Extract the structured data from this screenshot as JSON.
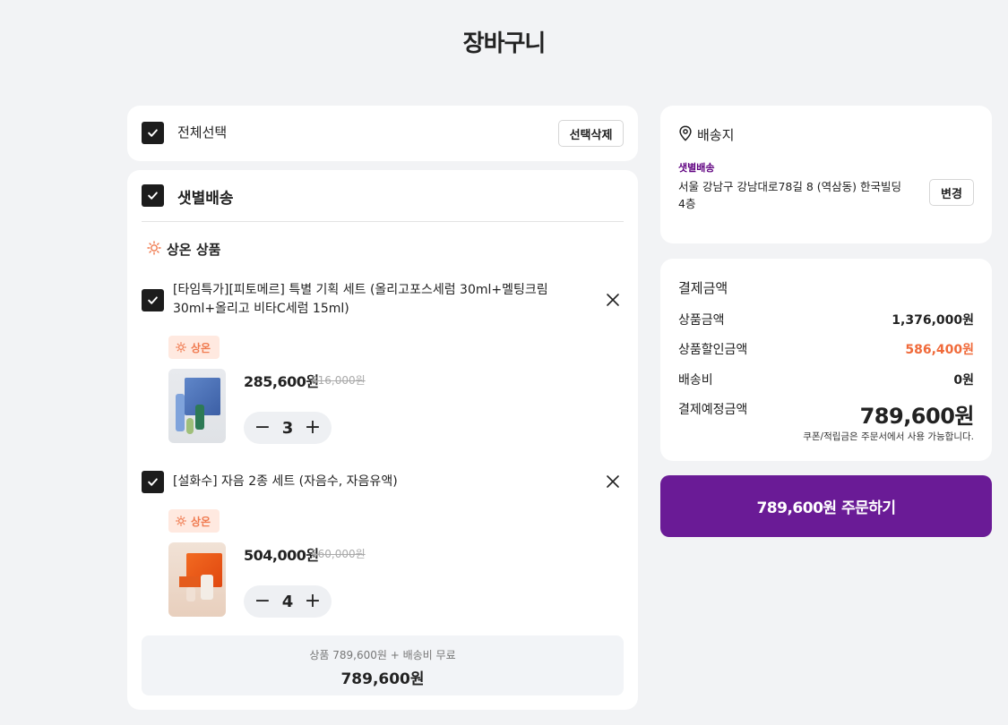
{
  "page": {
    "title": "장바구니"
  },
  "select_all": {
    "label": "전체선택",
    "delete_button": "선택삭제"
  },
  "group": {
    "title": "샛별배송",
    "section_title": "상온 상품",
    "items": [
      {
        "name": "[타임특가][피토메르] 특별 기획 세트 (올리고포스세럼 30ml+멜팅크림 30ml+올리고 비타C세럼 15ml)",
        "badge": "상온",
        "price": "285,600원",
        "original_price": "816,000원",
        "quantity": "3"
      },
      {
        "name": "[설화수] 자음 2종 세트 (자음수, 자음유액)",
        "badge": "상온",
        "price": "504,000원",
        "original_price": "560,000원",
        "quantity": "4"
      }
    ],
    "subtotal_caption": "상품 789,600원 + 배송비 무료",
    "subtotal": "789,600원"
  },
  "address": {
    "title": "배송지",
    "type": "샛별배송",
    "text": "서울 강남구 강남대로78길 8 (역삼동) 한국빌딩 4층",
    "change_button": "변경"
  },
  "payment": {
    "title": "결제금액",
    "rows": [
      {
        "label": "상품금액",
        "value": "1,376,000원"
      },
      {
        "label": "상품할인금액",
        "value": "586,400원"
      },
      {
        "label": "배송비",
        "value": "0원"
      }
    ],
    "total_label": "결제예정금액",
    "total_value": "789,600원",
    "note": "쿠폰/적립금은 주문서에서 사용 가능합니다."
  },
  "order_button": "789,600원 주문하기",
  "colors": {
    "accent": "#5f0080",
    "order_button": "#6a1b96",
    "discount": "#f06a3a",
    "badge_bg": "#ffe9e0",
    "badge_text": "#f07a4f"
  }
}
